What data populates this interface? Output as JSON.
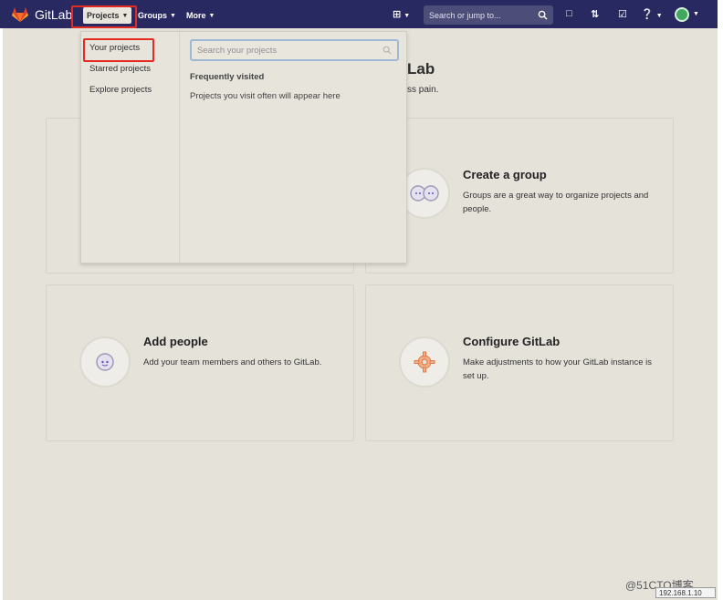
{
  "navbar": {
    "logo_text": "GitLab",
    "projects_label": "Projects",
    "groups_label": "Groups",
    "more_label": "More",
    "search_placeholder": "Search or jump to...",
    "bg_color": "#292961"
  },
  "dropdown": {
    "links": [
      "Your projects",
      "Starred projects",
      "Explore projects"
    ],
    "search_placeholder": "Search your projects",
    "frequent_heading": "Frequently visited",
    "frequent_text": "Projects you visit often will appear here"
  },
  "welcome": {
    "title_fragment": "Lab",
    "subtitle_fragment": "ss pain."
  },
  "cards": [
    {
      "title": "Create a group",
      "desc": "Groups are a great way to organize projects and people.",
      "icon": "group-icon"
    },
    {
      "title": "Add people",
      "desc": "Add your team members and others to GitLab.",
      "icon": "person-icon"
    },
    {
      "title": "Configure GitLab",
      "desc": "Make adjustments to how your GitLab instance is set up.",
      "icon": "gear-icon"
    }
  ],
  "footer": {
    "watermark": "@51CTO博客",
    "ip_text": "192.168.1.10"
  },
  "colors": {
    "highlight": "#e32b23",
    "page_bg": "#e5e2da"
  }
}
